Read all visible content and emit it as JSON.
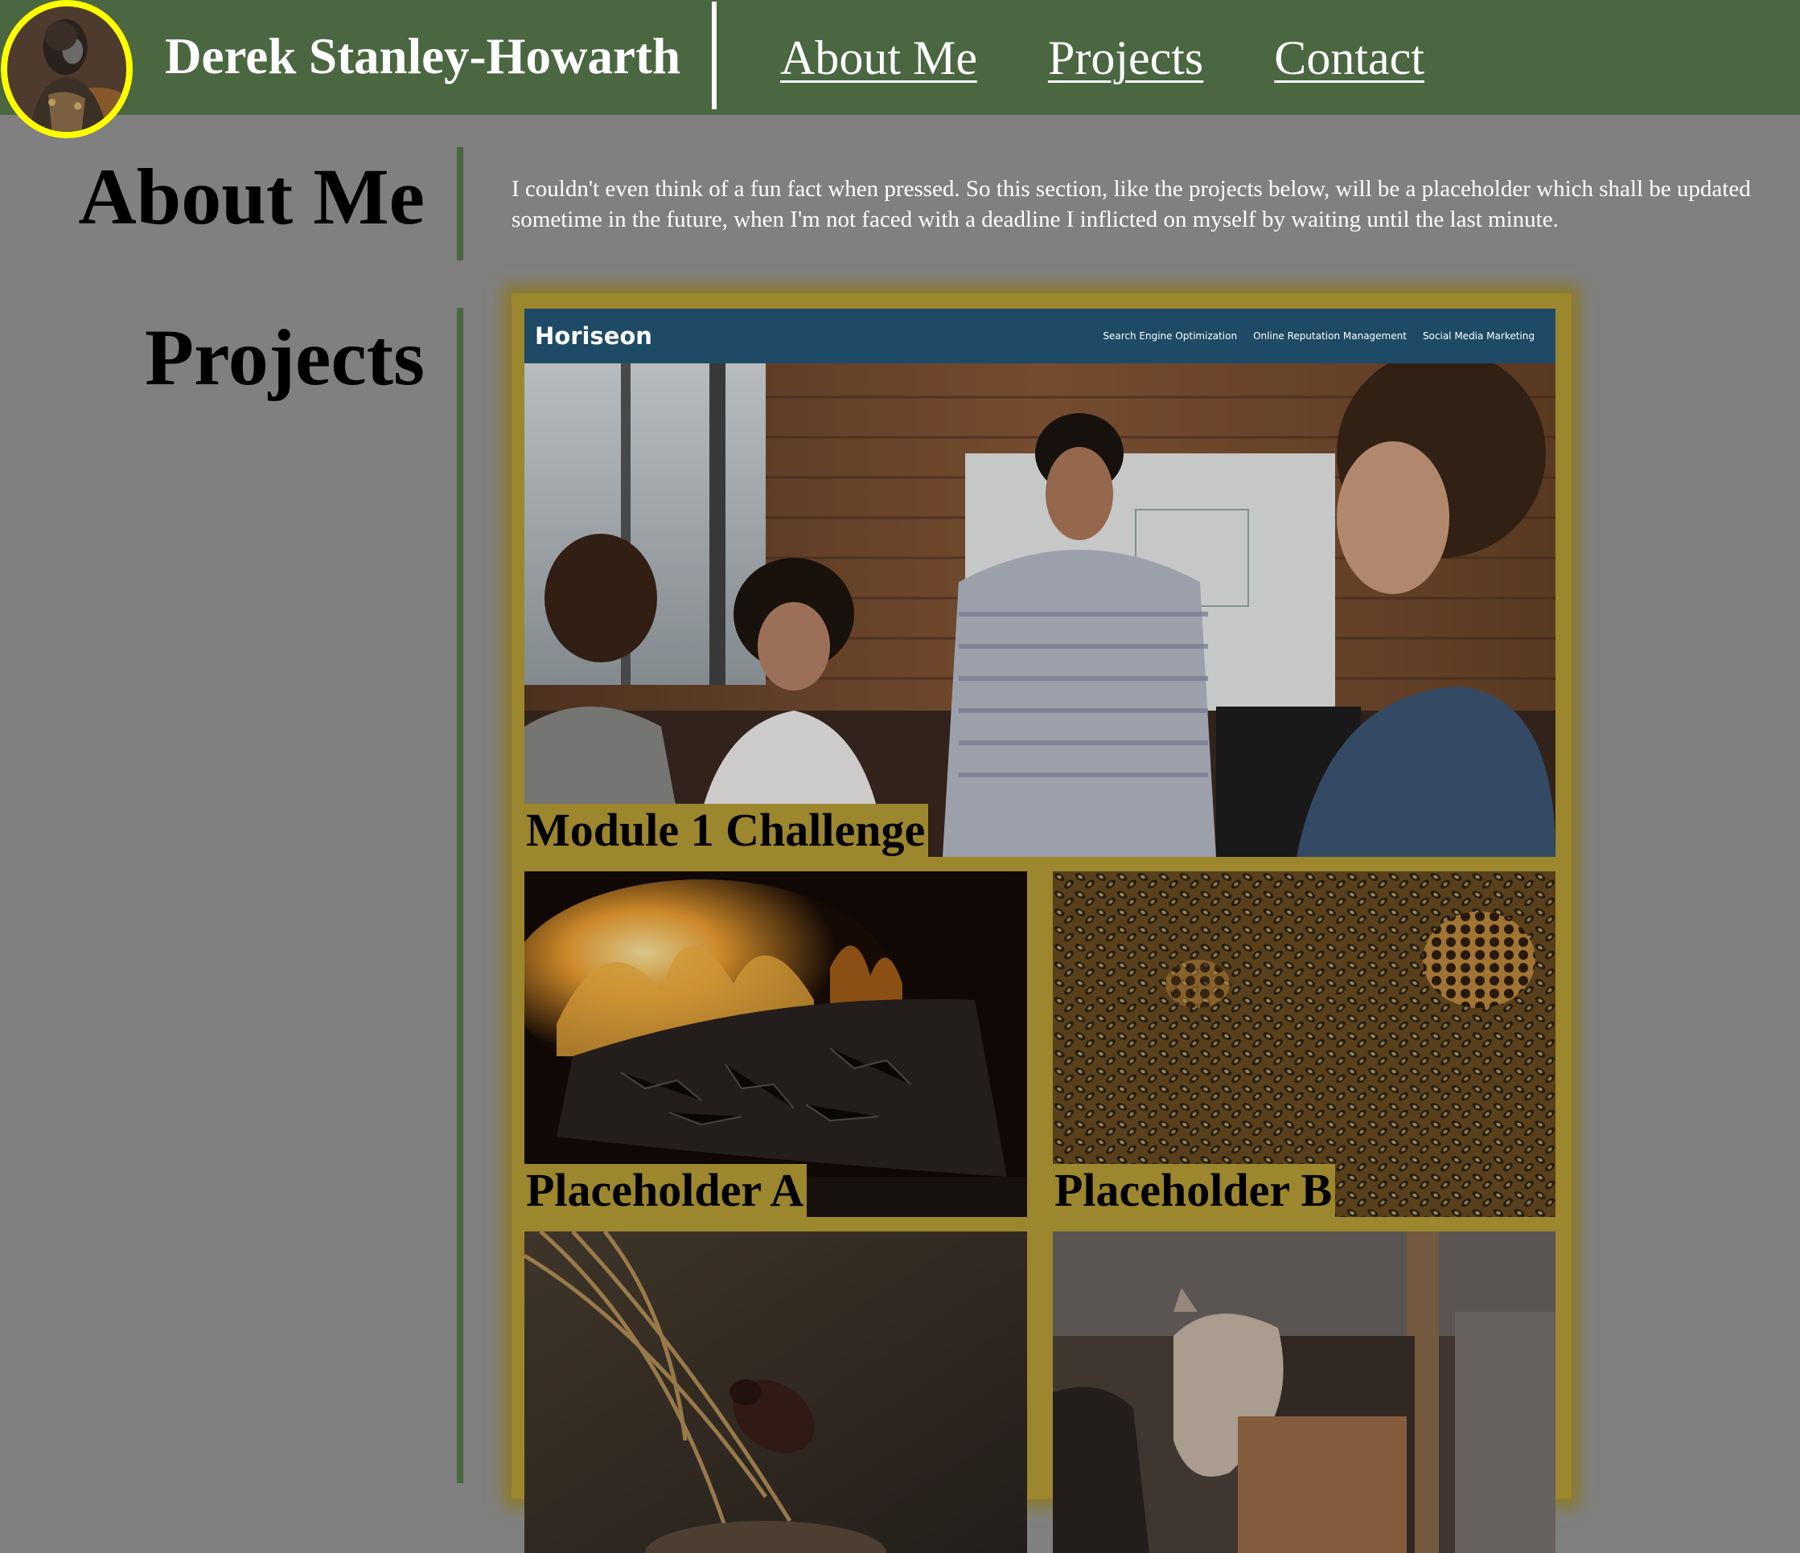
{
  "header": {
    "title": "Derek Stanley-Howarth",
    "nav": [
      "About Me",
      "Projects",
      "Contact"
    ],
    "bg_color": "#4a6741",
    "avatar_border_color": "#ffff00",
    "avatar_icon": "avatar-portrait"
  },
  "about": {
    "heading": "About Me",
    "text": "I couldn't even think of a fun fact when pressed. So this section, like the projects below, will be a placeholder which shall be updated sometime in the future, when I'm not faced with a deadline I inflicted on myself by waiting until the last minute."
  },
  "projects": {
    "heading": "Projects",
    "frame_color": "#9c862e",
    "main": {
      "label": "Module 1 Challenge",
      "screenshot_logo": "Horiseon",
      "screenshot_nav": [
        "Search Engine Optimization",
        "Online Reputation Management",
        "Social Media Marketing"
      ]
    },
    "cards": [
      {
        "label": "Placeholder A",
        "image": "fire-log-image"
      },
      {
        "label": "Placeholder B",
        "image": "bees-honeycomb-image"
      },
      {
        "label": "",
        "image": "beetle-straw-image"
      },
      {
        "label": "",
        "image": "horse-stable-image"
      }
    ]
  }
}
